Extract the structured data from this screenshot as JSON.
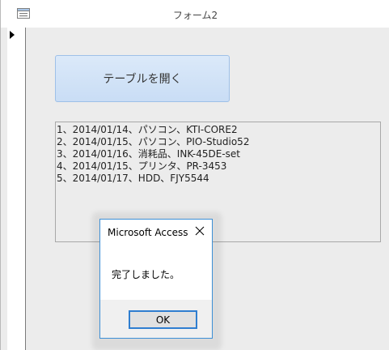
{
  "window": {
    "title": "フォーム2"
  },
  "form": {
    "open_table_button_label": "テーブルを開く",
    "list_items": [
      "1、2014/01/14、パソコン、KTI-CORE2",
      "2、2014/01/15、パソコン、PIO-Studio52",
      "3、2014/01/16、消耗品、INK-45DE-set",
      "4、2014/01/15、プリンタ、PR-3453",
      "5、2014/01/17、HDD、FJY5544"
    ]
  },
  "message_box": {
    "title": "Microsoft Access",
    "message": "完了しました。",
    "ok_label": "OK"
  },
  "colors": {
    "button_fill": "#c9ddf5",
    "dialog_border": "#3c8fd6",
    "ok_focus_border": "#2f7ed0"
  },
  "icons": [
    "form-icon",
    "record-selector-arrow-icon",
    "close-icon"
  ]
}
